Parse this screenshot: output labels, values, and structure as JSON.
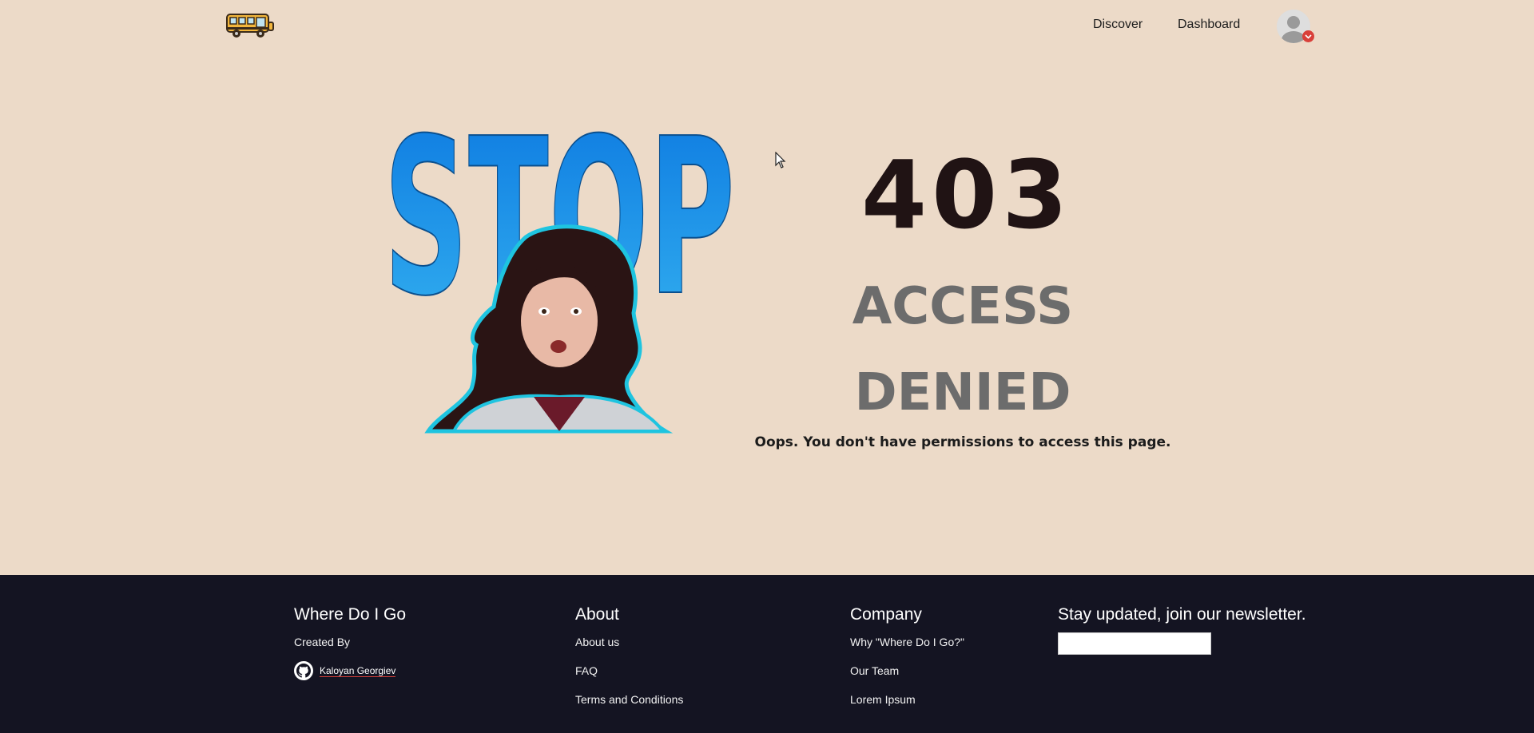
{
  "header": {
    "nav": [
      "Discover",
      "Dashboard"
    ]
  },
  "art": {
    "stop_word": "STOP"
  },
  "error": {
    "code": "403",
    "title_line1": "ACCESS",
    "title_line2": "DENIED",
    "message": "Oops. You don't have permissions to access this page."
  },
  "footer": {
    "brand": {
      "title": "Where Do I Go",
      "created_by": "Created By",
      "author": "Kaloyan Georgiev"
    },
    "about": {
      "title": "About",
      "links": [
        "About us",
        "FAQ",
        "Terms and Conditions"
      ]
    },
    "company": {
      "title": "Company",
      "links": [
        "Why \"Where Do I Go?\"",
        "Our Team",
        "Lorem Ipsum"
      ]
    },
    "newsletter": {
      "title": "Stay updated, join our newsletter.",
      "input_value": ""
    }
  },
  "colors": {
    "page_background": "#ecdac8",
    "footer_background": "#141422",
    "accent_red": "#d9403a",
    "stop_blue": "#1e90e8",
    "code_color": "#201314",
    "title_gray": "#6c6c6c"
  }
}
